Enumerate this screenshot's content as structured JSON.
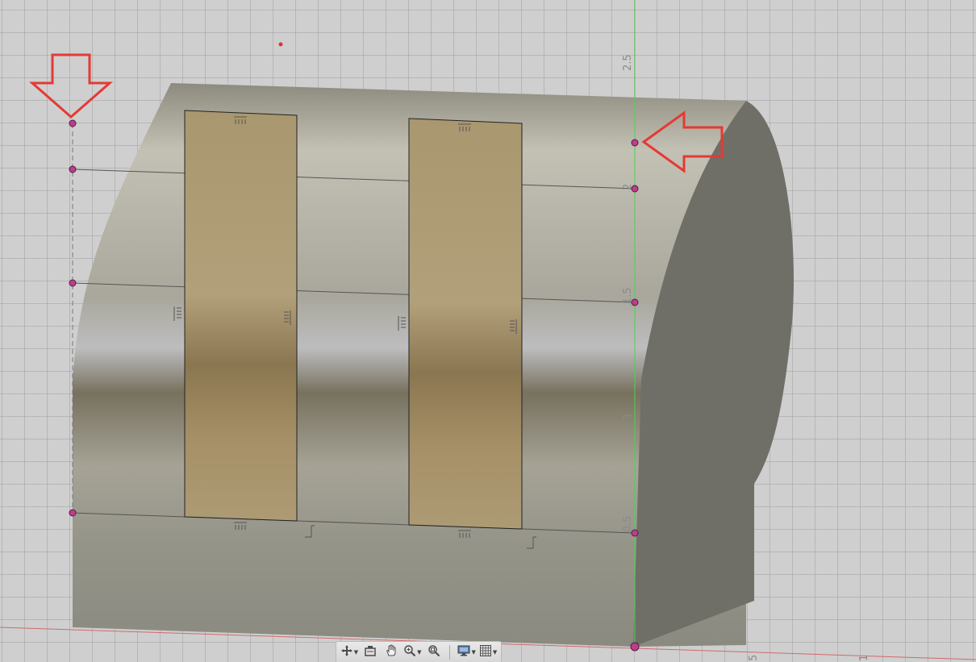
{
  "viewport": {
    "name": "3d-sketch-viewport",
    "axis_ticks_vertical": [
      "2.5",
      "2",
      "1.5",
      "1",
      "0.5"
    ],
    "axis_ticks_horizontal": [
      "5",
      "1"
    ]
  },
  "colors": {
    "grid": "#999999",
    "body": "#8d8b80",
    "end_face": "#6f6f68",
    "panel_fill": "#b39f72",
    "panel_edge": "#222222",
    "sketch_point": "#c03c8c",
    "annotation_arrow": "#e53935",
    "y_axis": "#33cc33",
    "x_axis": "#d05050"
  },
  "toolbar": {
    "orbit": {
      "icon": "orbit-icon"
    },
    "look_at": {
      "icon": "look-at-icon"
    },
    "pan": {
      "icon": "pan-hand-icon"
    },
    "zoom": {
      "icon": "zoom-icon"
    },
    "fit": {
      "icon": "fit-icon"
    },
    "display_settings": {
      "icon": "display-settings-icon"
    },
    "grid_snaps": {
      "icon": "grid-icon"
    }
  }
}
